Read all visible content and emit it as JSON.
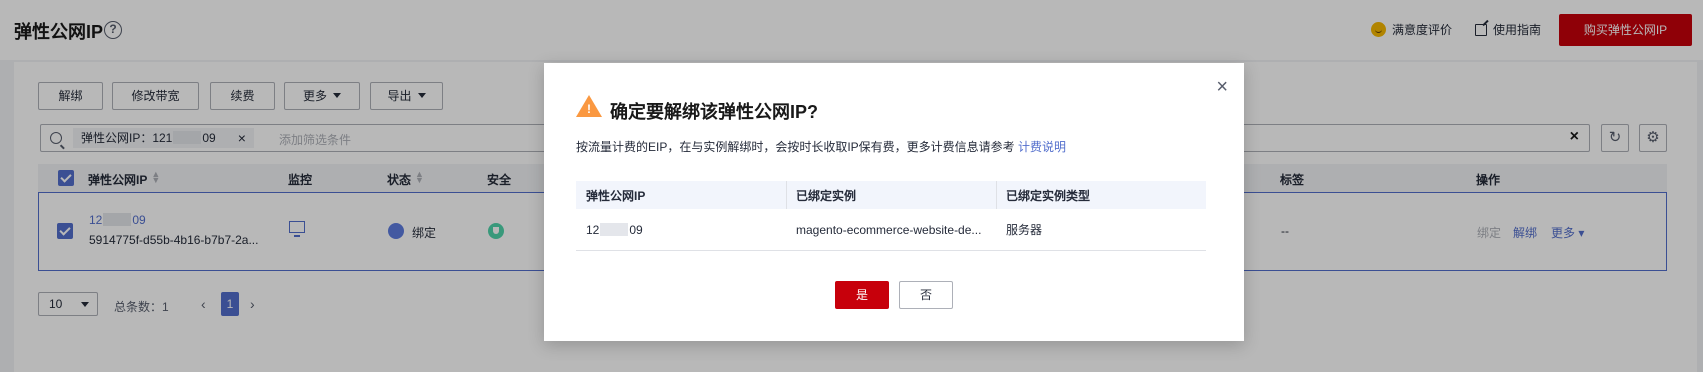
{
  "header": {
    "title": "弹性公网IP",
    "help_icon": "?",
    "satisfaction_label": "满意度评价",
    "guide_label": "使用指南",
    "buy_label": "购买弹性公网IP"
  },
  "toolbar": {
    "unbind_label": "解绑",
    "modify_bandwidth_label": "修改带宽",
    "renew_label": "续费",
    "more_label": "更多",
    "export_label": "导出"
  },
  "search": {
    "filter_tag_label": "弹性公网IP：121",
    "filter_tag_suffix": "09",
    "placeholder": "添加筛选条件"
  },
  "table": {
    "headers": {
      "ip": "弹性公网IP",
      "monitor": "监控",
      "status": "状态",
      "security": "安全",
      "tags": "标签",
      "actions": "操作"
    },
    "row": {
      "ip_prefix": "12",
      "ip_suffix": "09",
      "id": "5914775f-d55b-4b16-b7b7-2a...",
      "status": "绑定",
      "tags": "--",
      "action_bind": "绑定",
      "action_unbind": "解绑",
      "action_more": "更多"
    }
  },
  "pagination": {
    "page_size": "10",
    "total_label": "总条数：1",
    "current_page": "1",
    "prev": "‹",
    "next": "›"
  },
  "modal": {
    "title": "确定要解绑该弹性公网IP?",
    "description": "按流量计费的EIP，在与实例解绑时，会按时长收取IP保有费，更多计费信息请参考",
    "billing_link": "计费说明",
    "columns": {
      "ip": "弹性公网IP",
      "instance": "已绑定实例",
      "instance_type": "已绑定实例类型"
    },
    "row": {
      "ip_prefix": "12",
      "ip_suffix": "09",
      "instance": "magento-ecommerce-website-de...",
      "instance_type": "服务器"
    },
    "yes_label": "是",
    "no_label": "否",
    "close_icon": "×"
  },
  "colors": {
    "brand_red": "#c7000b",
    "link_blue": "#526ecc",
    "warning_orange": "#fa9841"
  }
}
